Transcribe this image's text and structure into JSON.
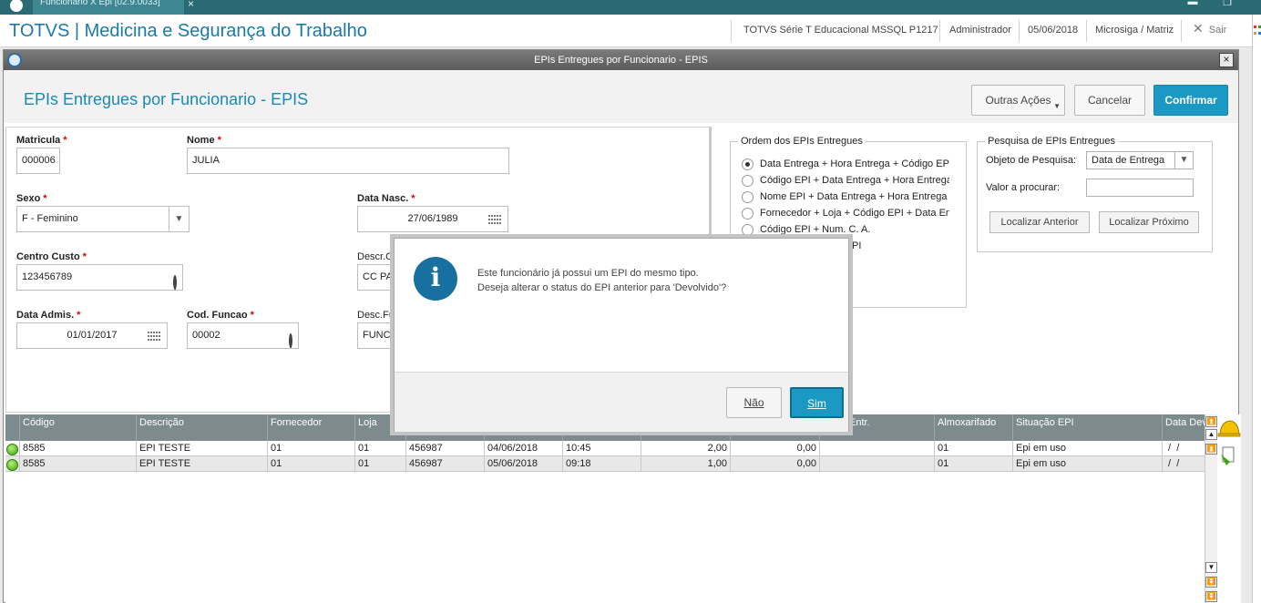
{
  "taskbar": {
    "tab_label": "Funcionario X Epi [02.9.0033]",
    "close_glyph": "×",
    "minimize_glyph": "▬",
    "restore_glyph": "❐"
  },
  "header": {
    "app_title": "TOTVS | Medicina e Segurança do Trabalho",
    "environment": "TOTVS Série T Educacional MSSQL P1217",
    "user": "Administrador",
    "date": "05/06/2018",
    "company": "Microsiga / Matriz",
    "exit_label": "Sair",
    "exit_glyph": "✕"
  },
  "window": {
    "title": "EPIs Entregues por Funcionario - EPIS",
    "close_glyph": "×"
  },
  "page": {
    "title": "EPIs Entregues por Funcionario - EPIS",
    "btn_outras": "Outras Ações",
    "btn_outras_glyph": "▼",
    "btn_cancelar": "Cancelar",
    "btn_confirmar": "Confirmar"
  },
  "form": {
    "required_mark": "*",
    "matricula": {
      "label": "Matricula",
      "value": "000006"
    },
    "nome": {
      "label": "Nome",
      "value": "JULIA"
    },
    "sexo": {
      "label": "Sexo",
      "value": "F - Feminino",
      "arrow": "▼"
    },
    "data_nasc": {
      "label": "Data Nasc.",
      "value": "27/06/1989"
    },
    "centro_custo": {
      "label": "Centro Custo",
      "value": "123456789"
    },
    "descr_cc": {
      "label": "Descr.C",
      "value": "CC PA"
    },
    "data_admis": {
      "label": "Data Admis.",
      "value": "01/01/2017"
    },
    "cod_funcao": {
      "label": "Cod. Funcao",
      "value": "00002"
    },
    "desc_funcao": {
      "label": "Desc.Fu",
      "value": "FUNCA"
    }
  },
  "order": {
    "legend": "Ordem dos EPIs Entregues",
    "options": [
      {
        "label": "Data Entrega + Hora Entrega + Código EPI",
        "selected": true
      },
      {
        "label": "Código EPI + Data Entrega + Hora Entrega",
        "selected": false
      },
      {
        "label": "Nome EPI + Data Entrega + Hora Entrega",
        "selected": false
      },
      {
        "label": "Fornecedor + Loja + Código EPI + Data Entr",
        "selected": false
      },
      {
        "label": "Código EPI +  Num. C. A.",
        "selected": false
      },
      {
        "label": "PI",
        "selected": false
      }
    ]
  },
  "search": {
    "legend": "Pesquisa de EPIs Entregues",
    "objeto_label": "Objeto de Pesquisa:",
    "objeto_value": "Data de Entrega",
    "objeto_arrow": "▼",
    "valor_label": "Valor a procurar:",
    "valor_value": "",
    "btn_anterior": "Localizar Anterior",
    "btn_proximo": "Localizar Próximo"
  },
  "grid": {
    "columns": [
      "Código",
      "Descrição",
      "Fornecedor",
      "Loja",
      "",
      "",
      "",
      "",
      "Entr.",
      "Almoxarifado",
      "Situação EPI",
      "Data Dev"
    ],
    "rows": [
      {
        "codigo": "8585",
        "descricao": "EPI TESTE",
        "fornecedor": "01",
        "loja": "01",
        "num": "456987",
        "data": "04/06/2018",
        "hora": "10:45",
        "qtd": "2,00",
        "qtd2": "0,00",
        "entr": "",
        "almox": "01",
        "situacao": "Epi em uso",
        "data_dev": " /  /"
      },
      {
        "codigo": "8585",
        "descricao": "EPI TESTE",
        "fornecedor": "01",
        "loja": "01",
        "num": "456987",
        "data": "05/06/2018",
        "hora": "09:18",
        "qtd": "1,00",
        "qtd2": "0,00",
        "entr": "",
        "almox": "01",
        "situacao": "Epi em uso",
        "data_dev": " /  /"
      }
    ],
    "scroll_up_glyph": "▲",
    "scroll_top_glyph": "⏫",
    "scroll_down_glyph": "▼",
    "scroll_bottom_glyph": "⏬"
  },
  "dialog": {
    "icon_glyph": "i",
    "line1": "Este funcionário já possui um EPI do mesmo tipo.",
    "line2": "Deseja alterar o status do EPI anterior para 'Devolvido'?",
    "btn_nao": "Não",
    "btn_sim": "Sim"
  },
  "colors": {
    "accent": "#1b98c4",
    "title_blue": "#1a7aa8",
    "required": "#dd0000",
    "status_green": "#3ca40e"
  }
}
